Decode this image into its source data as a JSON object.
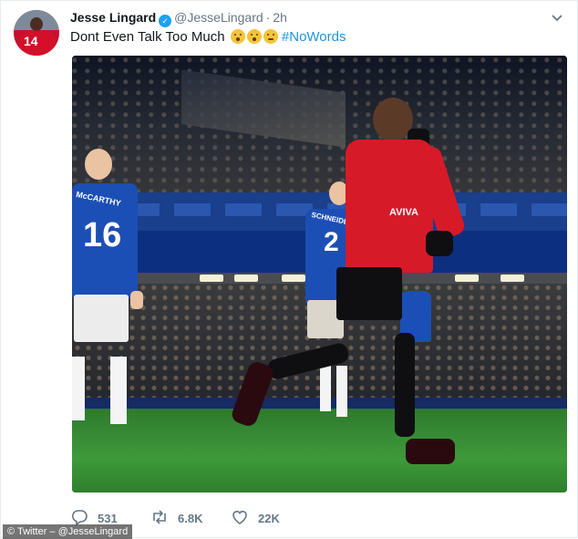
{
  "tweet": {
    "author_name": "Jesse Lingard",
    "handle": "@JesseLingard",
    "separator": "·",
    "time": "2h",
    "text": "Dont Even Talk Too Much",
    "emojis": [
      "shushing-face-emoji",
      "hand-over-mouth-emoji",
      "zipper-mouth-face-emoji"
    ],
    "hashtag": "#NoWords",
    "avatar_jersey_number": "14",
    "media": {
      "left_player_name": "McCARTHY",
      "left_player_number": "16",
      "mid_player_name": "SCHNEIDERLIN",
      "mid_player_number": "2",
      "sponsor": "AVIVA"
    }
  },
  "actions": {
    "replies": "531",
    "retweets": "6.8K",
    "likes": "22K"
  },
  "watermark": "© Twitter – @JesseLingard",
  "colors": {
    "link": "#1b95e0",
    "secondary_text": "#657786",
    "verified": "#1da1f2"
  }
}
